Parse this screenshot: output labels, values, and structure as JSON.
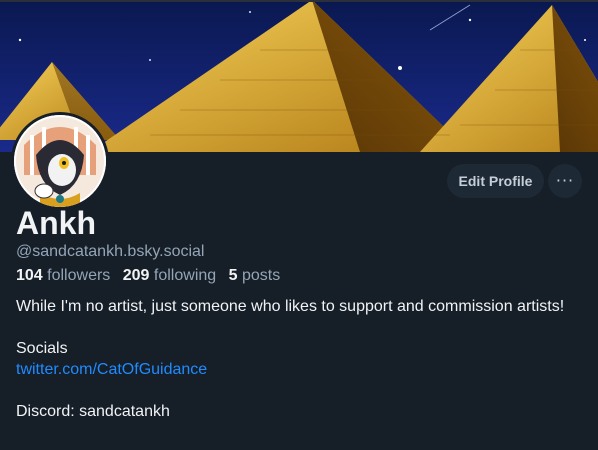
{
  "profile": {
    "display_name": "Ankh",
    "handle": "@sandcatankh.bsky.social"
  },
  "actions": {
    "edit_profile_label": "Edit Profile",
    "more_label": "···"
  },
  "stats": {
    "followers_count": "104",
    "followers_label": "followers",
    "following_count": "209",
    "following_label": "following",
    "posts_count": "5",
    "posts_label": "posts"
  },
  "bio": {
    "line1": "While I'm no artist, just someone who likes to support and commission artists!",
    "socials_heading": "Socials",
    "twitter_link": "twitter.com/CatOfGuidance",
    "discord": "Discord: sandcatankh"
  },
  "colors": {
    "background": "#161e27",
    "link": "#208bfe",
    "button_bg": "#1e2936",
    "muted_text": "#93a5b7"
  },
  "icons": {
    "more": "ellipsis-icon"
  }
}
